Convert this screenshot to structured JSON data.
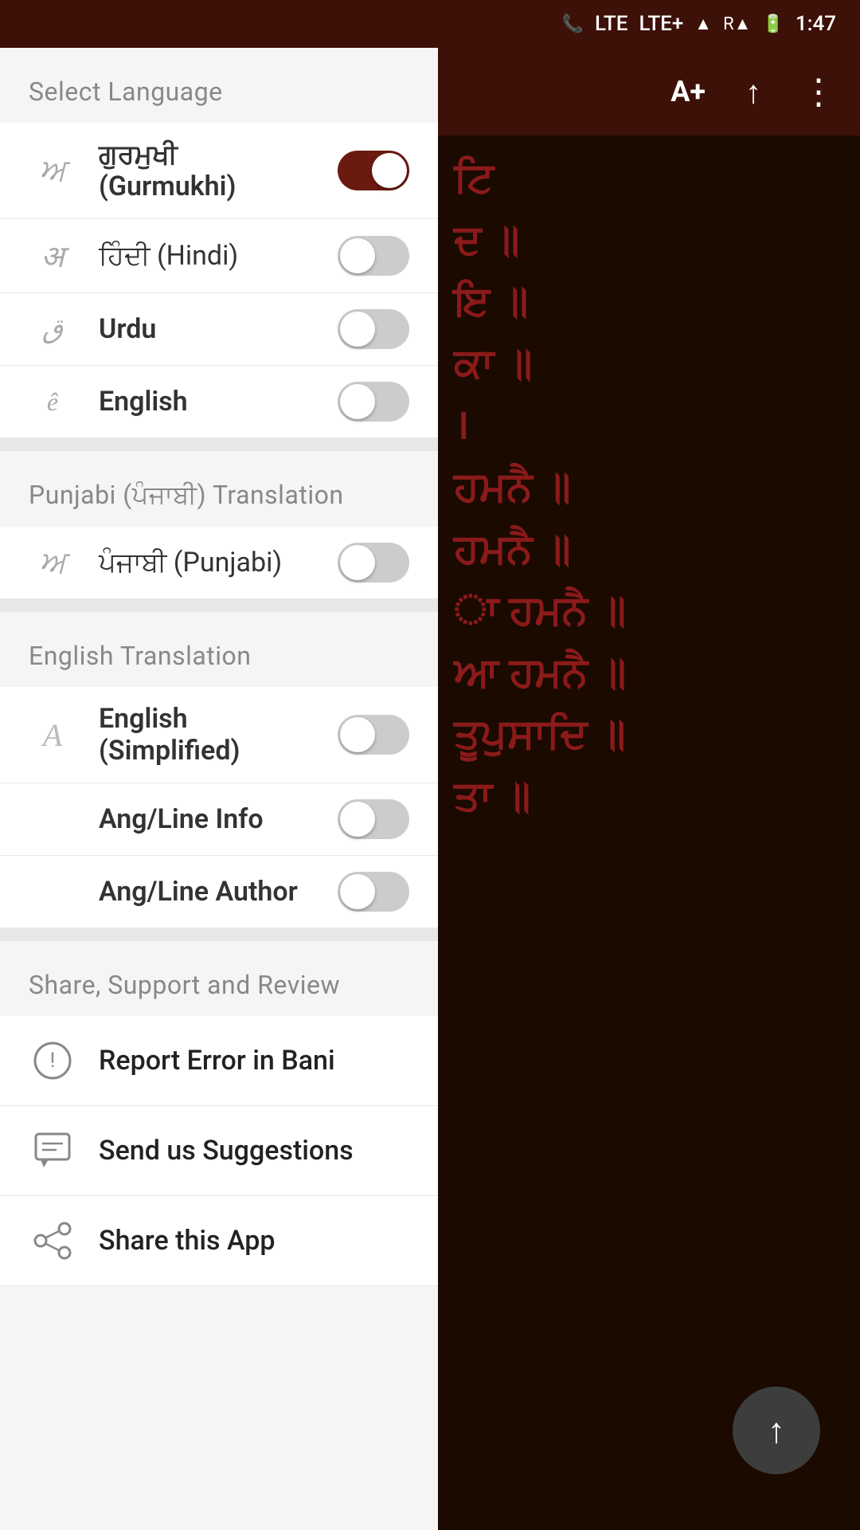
{
  "statusBar": {
    "lte": "LTE",
    "ltePlus": "LTE+",
    "time": "1:47",
    "battery": "100"
  },
  "topBar": {
    "fontSizeBtn": "A+",
    "scrollUpBtn": "↑",
    "menuBtn": "⋮"
  },
  "darkContent": {
    "lines": [
      "ਟਿ",
      "ਦ ॥",
      "ਇ ॥",
      "ਕਾ ॥",
      "।",
      "ਹਮਨੈ ॥",
      "ਹਮਨੈ ॥",
      "ਾ ਹਮਨੈ ॥",
      "ਆ ਹਮਨੈ ॥",
      "ਤੂਪੁਸਾਦਿ ॥",
      "ਤਾ ॥"
    ]
  },
  "drawer": {
    "selectLanguage": {
      "sectionHeader": "Select Language",
      "items": [
        {
          "icon": "ਅ",
          "label": "ਗੁਰਮੁਖੀ (Gurmukhi)",
          "bold": true,
          "toggleOn": true
        },
        {
          "icon": "अ",
          "label": "ਹਿੰਦੀ (Hindi)",
          "bold": false,
          "toggleOn": false
        },
        {
          "icon": "ق",
          "label": "Urdu",
          "bold": true,
          "toggleOn": false
        },
        {
          "icon": "ê",
          "label": "English",
          "bold": true,
          "toggleOn": false
        }
      ]
    },
    "punjabiTranslation": {
      "sectionHeader": "Punjabi (ਪੰਜਾਬੀ) Translation",
      "items": [
        {
          "icon": "ਅ",
          "label": "ਪੰਜਾਬੀ (Punjabi)",
          "bold": false,
          "toggleOn": false
        }
      ]
    },
    "englishTranslation": {
      "sectionHeader": "English Translation",
      "items": [
        {
          "icon": "A",
          "label": "English (Simplified)",
          "bold": true,
          "toggleOn": false
        },
        {
          "icon": "",
          "label": "Ang/Line Info",
          "bold": true,
          "toggleOn": false
        },
        {
          "icon": "",
          "label": "Ang/Line Author",
          "bold": true,
          "toggleOn": false
        }
      ]
    },
    "shareSupportReview": {
      "sectionHeader": "Share, Support and Review",
      "items": [
        {
          "icon": "alert",
          "label": "Report Error in Bani"
        },
        {
          "icon": "chat",
          "label": "Send us Suggestions"
        },
        {
          "icon": "share",
          "label": "Share this App"
        }
      ]
    }
  }
}
